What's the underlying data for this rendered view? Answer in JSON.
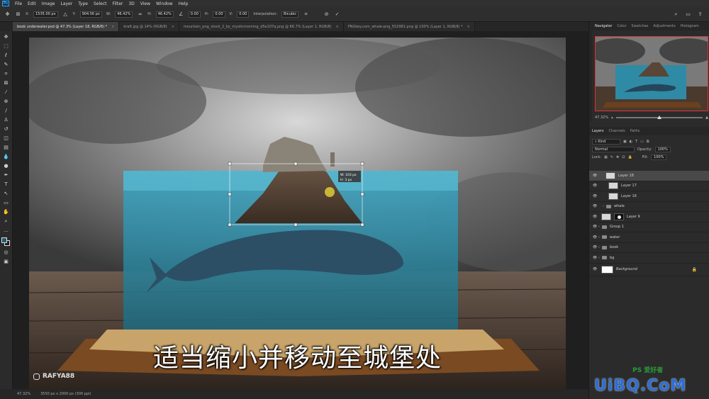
{
  "menubar": {
    "logo": "Ps",
    "items": [
      "File",
      "Edit",
      "Image",
      "Layer",
      "Type",
      "Select",
      "Filter",
      "3D",
      "View",
      "Window",
      "Help"
    ]
  },
  "options": {
    "x_label": "X:",
    "x_value": "1535.00 px",
    "y_label": "Y:",
    "y_value": "904.56 px",
    "w_label": "W:",
    "w_value": "46.42%",
    "h_label": "H:",
    "h_value": "46.42%",
    "angle_value": "0.00",
    "hskew_label": "H:",
    "hskew_value": "0.00",
    "vskew_label": "V:",
    "vskew_value": "0.00",
    "interp_label": "Interpolation:",
    "interp_value": "Bicubic"
  },
  "tabs": [
    {
      "label": "book underwater.psd @ 47.3% (Layer 18, RGB/8) *",
      "active": true
    },
    {
      "label": "kraft.jpg @ 14% (RGB/8)",
      "active": false
    },
    {
      "label": "mountain_png_stock_2_by_mysticmorning_d5e107q.png @ 66.7% (Layer 1, RGB/8)",
      "active": false
    },
    {
      "label": "PNGkey.com_whale-png_552981.png @ 100% (Layer 1, RGB/8) *",
      "active": false
    }
  ],
  "transform_readout": {
    "w": "W: 103 px",
    "h": "H: 3 px"
  },
  "caption": "适当缩小并移动至城堡处",
  "instagram": "RAFYA88",
  "status": {
    "zoom": "47.32%",
    "doc": "3550 px x 2000 px (300 ppi)"
  },
  "navigator": {
    "tabs": [
      "Navigator",
      "Color",
      "Swatches",
      "Adjustments",
      "Histogram"
    ],
    "zoom": "47.32%"
  },
  "layers": {
    "tabs": [
      "Layers",
      "Channels",
      "Paths"
    ],
    "kind_label": "Kind",
    "blend_mode": "Normal",
    "opacity_label": "Opacity:",
    "opacity_value": "100%",
    "lock_label": "Lock:",
    "fill_label": "Fill:",
    "fill_value": "100%",
    "items": [
      {
        "name": "Layer 18",
        "type": "layer",
        "selected": true,
        "indent": 0
      },
      {
        "name": "Layer 17",
        "type": "layer",
        "selected": false,
        "indent": 1
      },
      {
        "name": "Layer 16",
        "type": "layer",
        "selected": false,
        "indent": 1
      },
      {
        "name": "whale",
        "type": "group",
        "selected": false,
        "indent": 1
      },
      {
        "name": "Layer 9",
        "type": "masked",
        "selected": false,
        "indent": 0
      },
      {
        "name": "Group 1",
        "type": "group",
        "selected": false,
        "indent": 0
      },
      {
        "name": "water",
        "type": "group",
        "selected": false,
        "indent": 0
      },
      {
        "name": "book",
        "type": "group",
        "selected": false,
        "indent": 0
      },
      {
        "name": "bg",
        "type": "group",
        "selected": false,
        "indent": 0
      },
      {
        "name": "Background",
        "type": "background",
        "selected": false,
        "indent": 0
      }
    ]
  },
  "watermark": {
    "site": "UiBQ.CoM",
    "cn": "PS 爱好者"
  },
  "colors": {
    "foreground": "#1b5c72",
    "background": "#1a1a1a",
    "accent": "#31a8ff"
  }
}
